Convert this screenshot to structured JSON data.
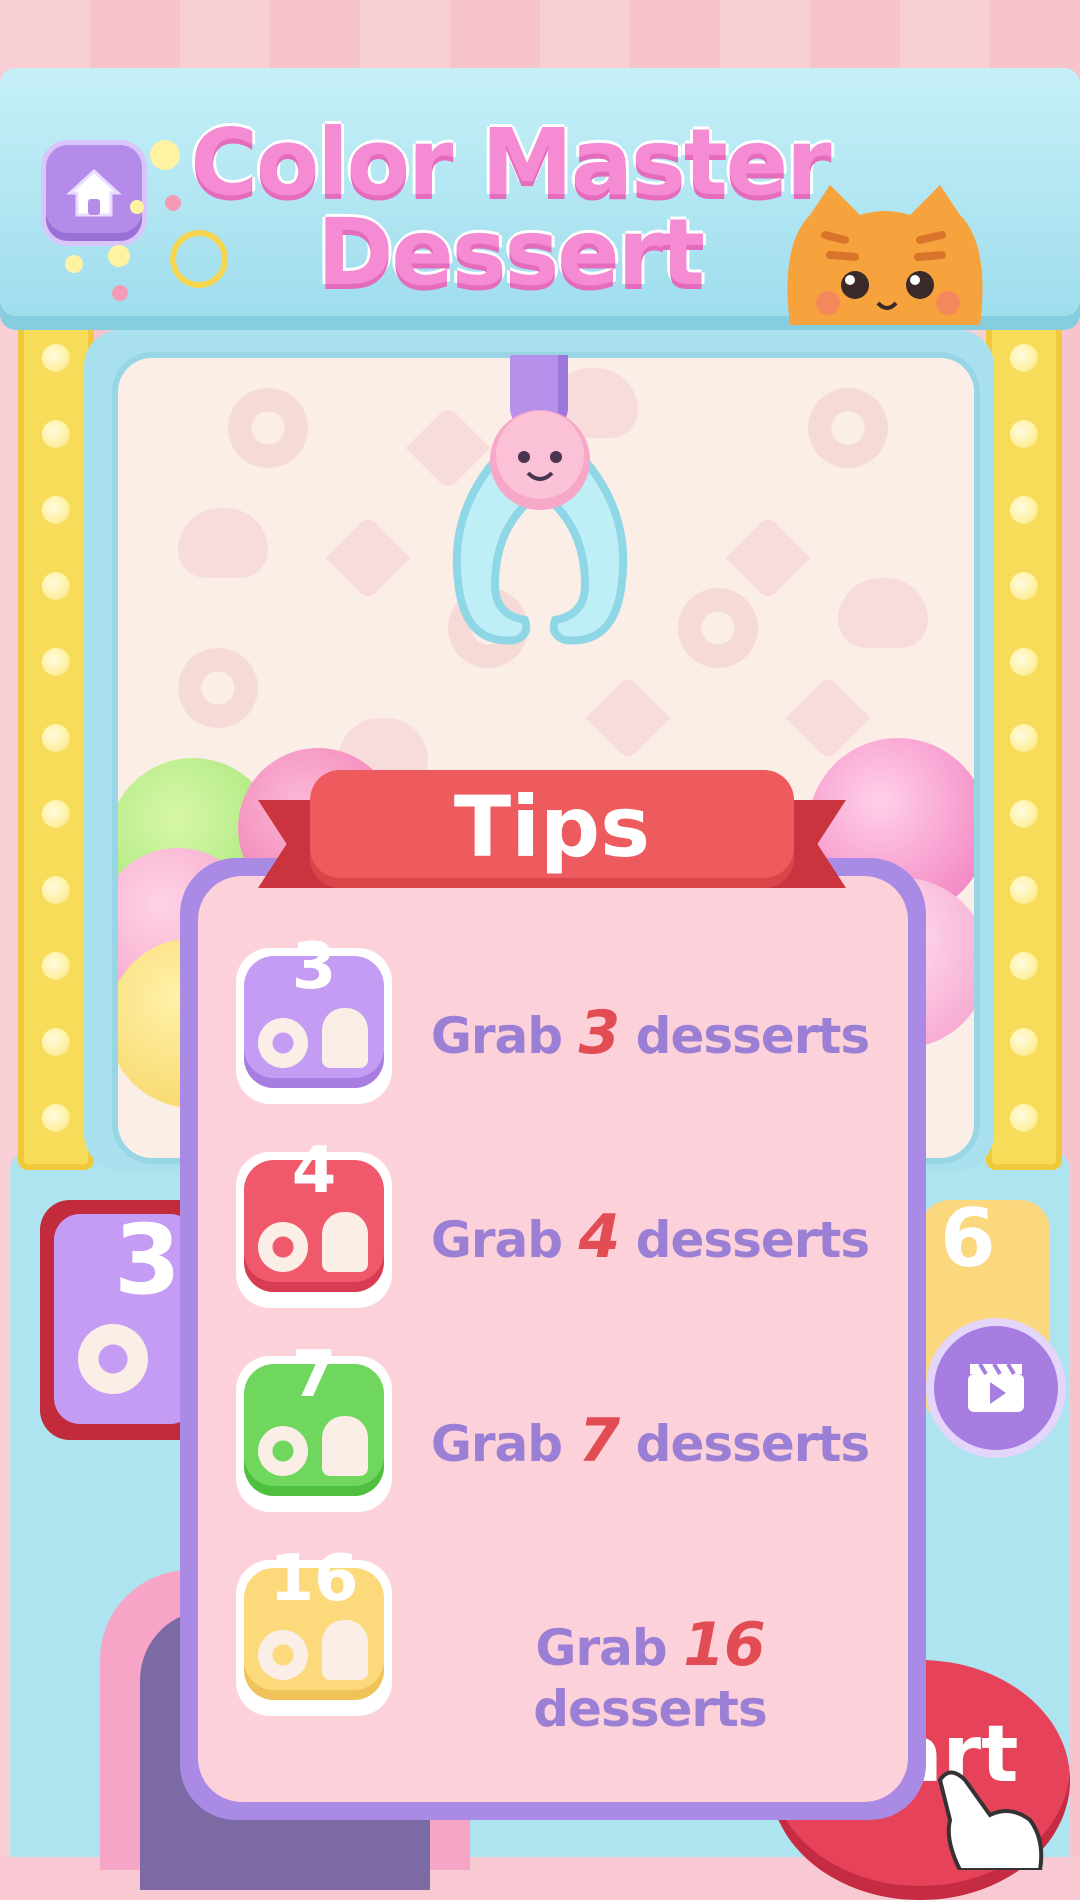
{
  "header": {
    "title_line1": "Color Master",
    "title_line2": "Dessert"
  },
  "machine": {
    "left_card_count": "3",
    "right_card_count": "6",
    "start_label": "art"
  },
  "tips": {
    "title": "Tips",
    "items": [
      {
        "badge": "3",
        "prefix": "Grab",
        "count": "3",
        "suffix": "desserts",
        "color": "#c59cf3"
      },
      {
        "badge": "4",
        "prefix": "Grab",
        "count": "4",
        "suffix": "desserts",
        "color": "#f0596c"
      },
      {
        "badge": "7",
        "prefix": "Grab",
        "count": "7",
        "suffix": "desserts",
        "color": "#6fd65e"
      },
      {
        "badge": "16",
        "prefix": "Grab",
        "count": "16",
        "suffix": "desserts",
        "color": "#fcd97a"
      }
    ]
  },
  "icons": {
    "home": "home-icon",
    "video": "video-play-icon"
  }
}
